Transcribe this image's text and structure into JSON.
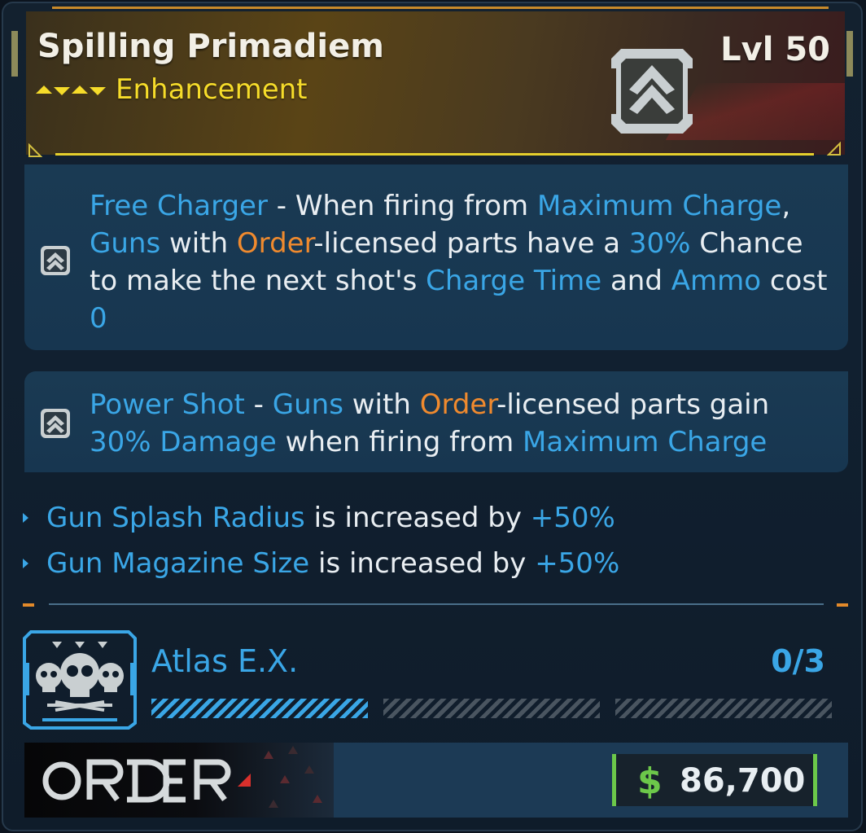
{
  "item": {
    "name": "Spilling Primadiem",
    "level": "Lvl 50",
    "rarity": "Enhancement"
  },
  "skills": [
    {
      "icon": "chevron-up-class-icon",
      "parts": [
        {
          "t": "Free Charger",
          "c": "k"
        },
        {
          "t": " - When firing from ",
          "c": ""
        },
        {
          "t": "Maximum Charge",
          "c": "k"
        },
        {
          "t": ", ",
          "c": ""
        },
        {
          "t": "Guns",
          "c": "k"
        },
        {
          "t": " with ",
          "c": ""
        },
        {
          "t": "Order",
          "c": "o"
        },
        {
          "t": "-licensed parts have a ",
          "c": ""
        },
        {
          "t": "30%",
          "c": "k"
        },
        {
          "t": " Chance to make the next shot's ",
          "c": ""
        },
        {
          "t": "Charge Time",
          "c": "k"
        },
        {
          "t": " and ",
          "c": ""
        },
        {
          "t": "Ammo",
          "c": "k"
        },
        {
          "t": " cost ",
          "c": ""
        },
        {
          "t": "0",
          "c": "k"
        }
      ]
    },
    {
      "icon": "chevron-up-class-icon",
      "parts": [
        {
          "t": "Power Shot",
          "c": "k"
        },
        {
          "t": " - ",
          "c": ""
        },
        {
          "t": "Guns",
          "c": "k"
        },
        {
          "t": " with ",
          "c": ""
        },
        {
          "t": "Order",
          "c": "o"
        },
        {
          "t": "-licensed parts gain ",
          "c": ""
        },
        {
          "t": "30% Damage",
          "c": "k"
        },
        {
          "t": " when firing from ",
          "c": ""
        },
        {
          "t": "Maximum Charge",
          "c": "k"
        }
      ]
    }
  ],
  "bonuses": [
    {
      "stat": "Gun Splash Radius",
      "text": " is increased by ",
      "value": "+50%"
    },
    {
      "stat": "Gun Magazine Size",
      "text": " is increased by ",
      "value": "+50%"
    }
  ],
  "set": {
    "name": "Atlas E.X.",
    "count": "0/3",
    "icon": "skulls-icon",
    "progress_filled": 1,
    "progress_total": 3
  },
  "manufacturer": {
    "name": "ORDER"
  },
  "price": {
    "symbol": "$",
    "value": "86,700"
  },
  "colors": {
    "keyword": "#3aa6e6",
    "manufacturer_keyword": "#f08a2e",
    "rarity": "#f6dc2a",
    "price": "#6cc84a"
  }
}
